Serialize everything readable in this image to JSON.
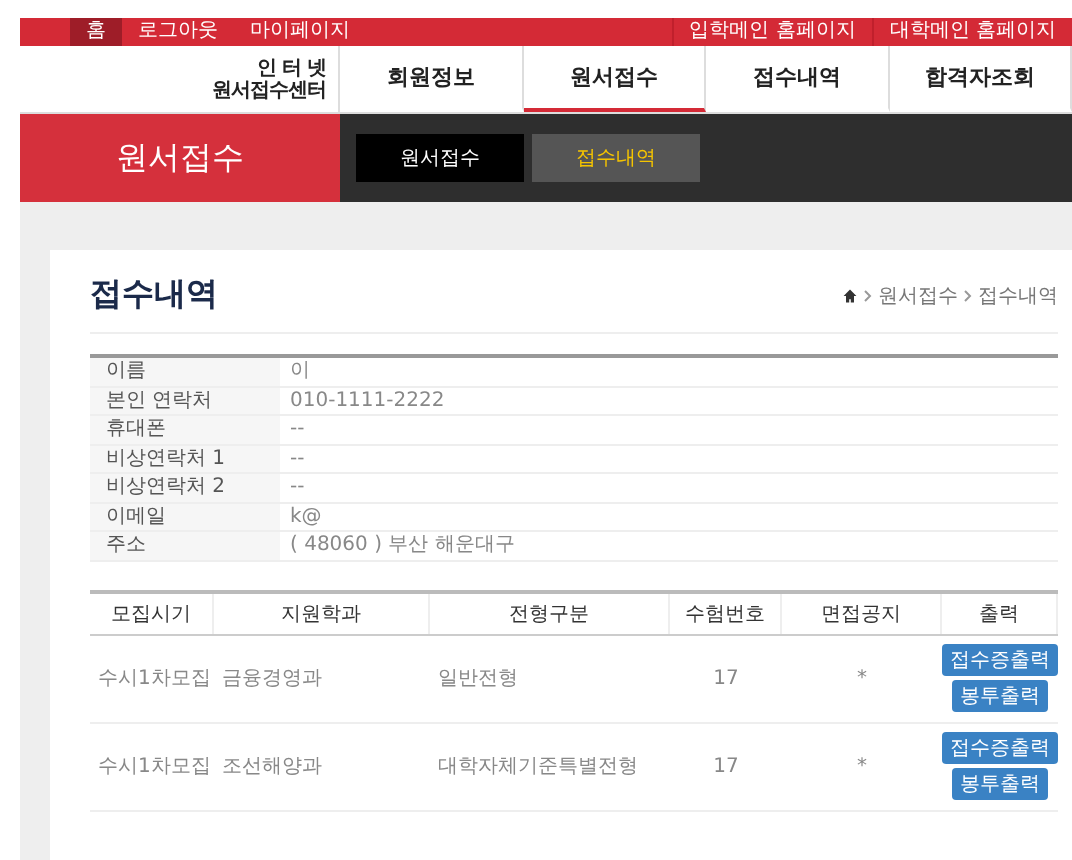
{
  "top_bar": {
    "left_links": [
      {
        "label": "홈",
        "selected": true
      },
      {
        "label": "로그아웃",
        "selected": false
      },
      {
        "label": "마이페이지",
        "selected": false
      }
    ],
    "right_links": [
      {
        "label": "입학메인 홈페이지"
      },
      {
        "label": "대학메인 홈페이지"
      }
    ]
  },
  "logo": {
    "lines": [
      "인 터 넷",
      "원서접수센터"
    ]
  },
  "nav": [
    {
      "label": "회원정보",
      "selected": false
    },
    {
      "label": "원서접수",
      "selected": true
    },
    {
      "label": "접수내역",
      "selected": false
    },
    {
      "label": "합격자조회",
      "selected": false
    }
  ],
  "banner": {
    "title": "원서접수",
    "tabs": [
      {
        "label": "원서접수",
        "selected": false
      },
      {
        "label": "접수내역",
        "selected": true
      }
    ]
  },
  "page": {
    "title": "접수내역",
    "breadcrumb": [
      "원서접수",
      "접수내역"
    ]
  },
  "profile": [
    {
      "label": "이름",
      "value": "이"
    },
    {
      "label": "본인 연락처",
      "value": "010-1111-2222"
    },
    {
      "label": "휴대폰",
      "value": "--"
    },
    {
      "label": "비상연락처 1",
      "value": "--"
    },
    {
      "label": "비상연락처 2",
      "value": "--"
    },
    {
      "label": "이메일",
      "value": "k@"
    },
    {
      "label": "주소",
      "value": "( 48060 ) 부산 해운대구"
    }
  ],
  "applications": {
    "columns": [
      "모집시기",
      "지원학과",
      "전형구분",
      "수험번호",
      "면접공지",
      "출력"
    ],
    "rows": [
      {
        "cells": [
          "수시1차모집",
          "금융경영과",
          "일반전형",
          "17",
          "*"
        ],
        "buttons": [
          "접수증출력",
          "봉투출력"
        ]
      },
      {
        "cells": [
          "수시1차모집",
          "조선해양과",
          "대학자체기준특별전형",
          "17",
          "*"
        ],
        "buttons": [
          "접수증출력",
          "봉투출력"
        ]
      }
    ]
  }
}
